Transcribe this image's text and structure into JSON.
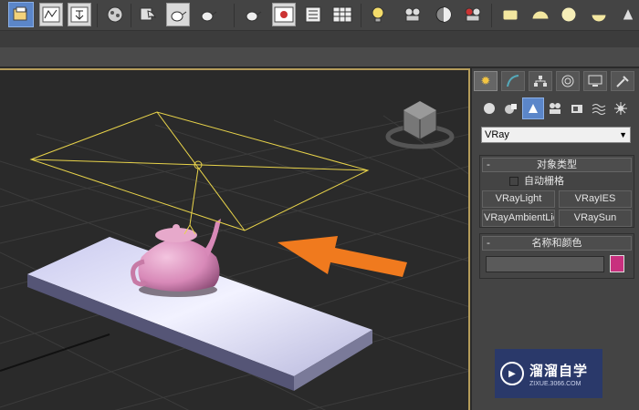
{
  "toolbar": {
    "icons": [
      "open-file-icon",
      "curve-editor-icon",
      "render-frame-icon",
      "material-editor-icon",
      "render-setup-icon",
      "teapot-render-icon",
      "teapot-activeshade-icon",
      "teapot-light-icon",
      "frame-buffer-icon",
      "list-icon",
      "grid-list-icon",
      "light-bulb-icon",
      "camera-icon",
      "sphere-icon",
      "film-camera-icon",
      "rect-light-icon",
      "dome-light-icon",
      "sphere-light-icon",
      "ies-light-icon",
      "sun-icon"
    ]
  },
  "panel": {
    "tabs": [
      "create-tab",
      "modify-tab",
      "hierarchy-tab",
      "motion-tab",
      "display-tab",
      "utilities-tab"
    ],
    "categories": [
      "geometry-icon",
      "shapes-icon",
      "lights-icon",
      "cameras-icon",
      "helpers-icon",
      "space-warps-icon",
      "systems-icon"
    ],
    "dropdown_value": "VRay",
    "object_type": {
      "title": "对象类型",
      "collapse": "-",
      "autogrid_label": "自动栅格",
      "buttons": [
        "VRayLight",
        "VRayIES",
        "VRayAmbientLight",
        "VRaySun"
      ]
    },
    "name_color": {
      "title": "名称和颜色",
      "collapse": "-",
      "swatch_color": "#c8307e"
    }
  },
  "watermark": {
    "main": "溜溜自学",
    "sub": "ZIXUE.3066.COM"
  },
  "colors": {
    "accent": "#5b86c9",
    "light_gizmo": "#e8d34a",
    "arrow": "#f07a1e",
    "teapot": "#d889b8"
  }
}
